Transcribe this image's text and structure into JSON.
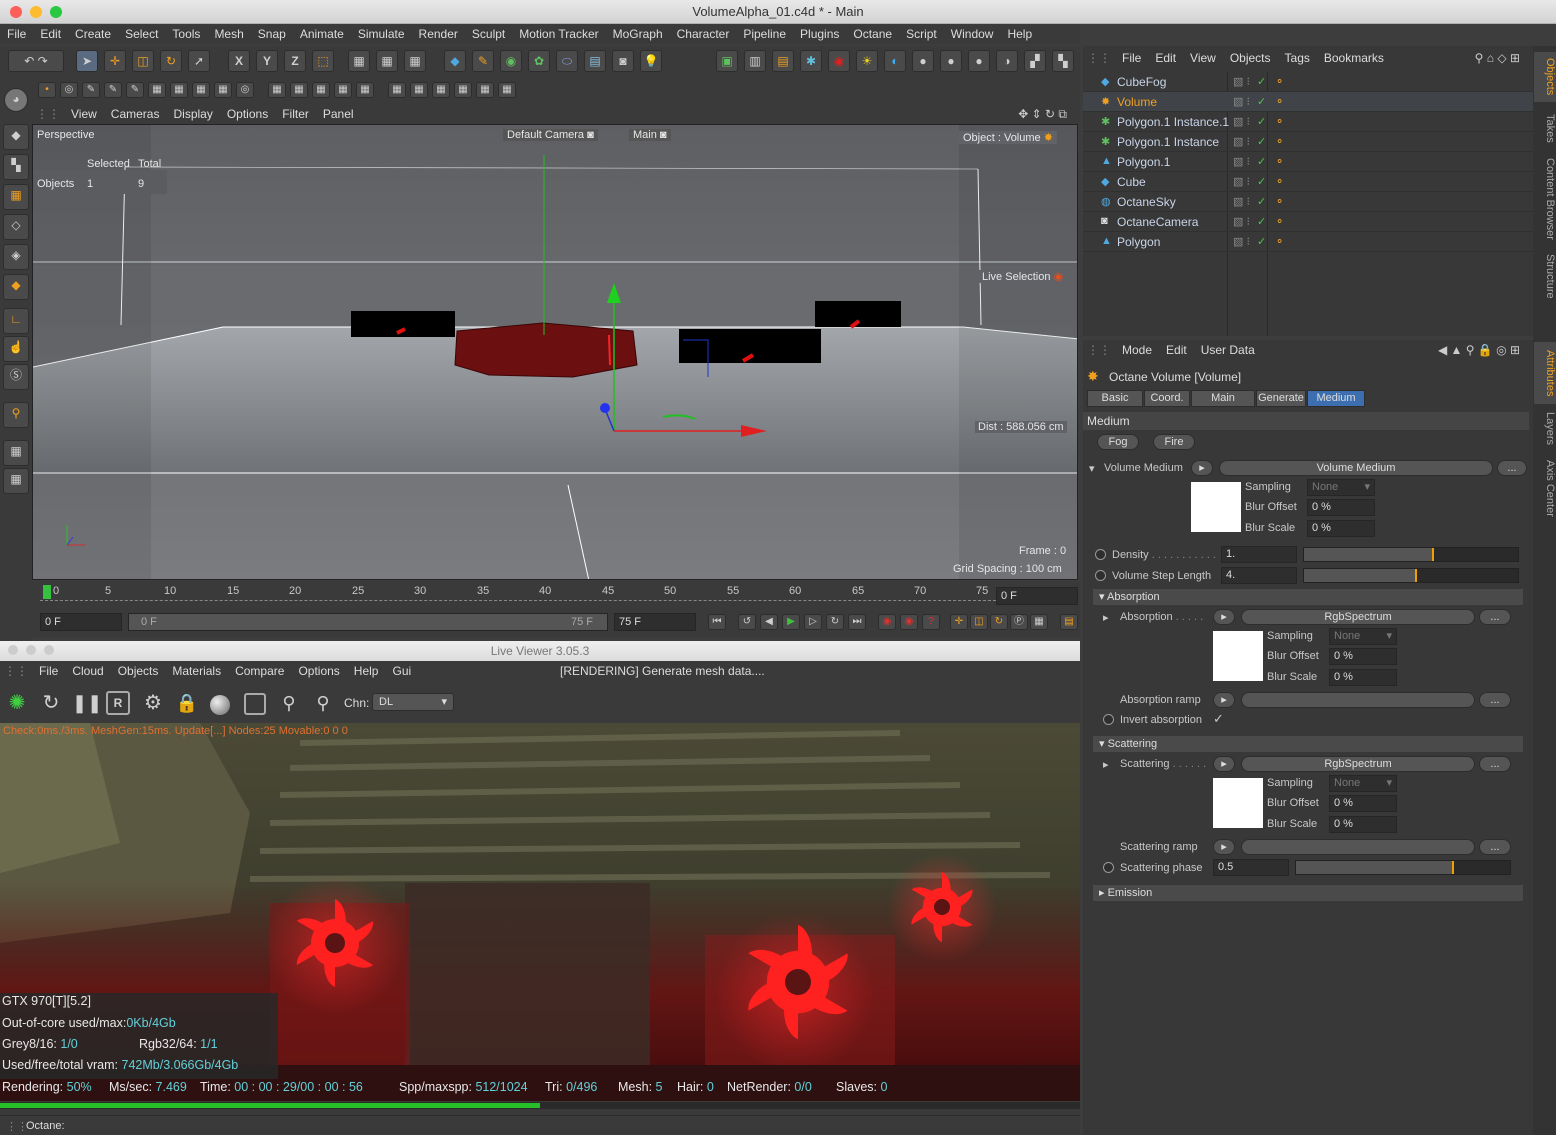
{
  "window": {
    "title": "VolumeAlpha_01.c4d * - Main"
  },
  "menubar": [
    "File",
    "Edit",
    "Create",
    "Select",
    "Tools",
    "Mesh",
    "Snap",
    "Animate",
    "Simulate",
    "Render",
    "Sculpt",
    "Motion Tracker",
    "MoGraph",
    "Character",
    "Pipeline",
    "Plugins",
    "Octane",
    "Script",
    "Window",
    "Help"
  ],
  "toolbar": {
    "axis_x": "X",
    "axis_y": "Y",
    "axis_z": "Z"
  },
  "viewport": {
    "menu": [
      "View",
      "Cameras",
      "Display",
      "Options",
      "Filter",
      "Panel"
    ],
    "name": "Perspective",
    "camera": "Default Camera",
    "main": "Main",
    "object_label": "Object : Volume",
    "stats_header_selected": "Selected",
    "stats_header_total": "Total",
    "stats_row_label": "Objects",
    "stats_selected": "1",
    "stats_total": "9",
    "live_selection": "Live Selection",
    "dist": "Dist : 588.056 cm",
    "frame": "Frame : 0",
    "grid_spacing": "Grid Spacing : 100 cm"
  },
  "timeline": {
    "ticks": [
      "0",
      "5",
      "10",
      "15",
      "20",
      "25",
      "30",
      "35",
      "40",
      "45",
      "50",
      "55",
      "60",
      "65",
      "70",
      "75"
    ],
    "current_frame": "0 F",
    "start_field": "0 F",
    "range_start": "0 F",
    "range_end": "75 F",
    "end_field": "75 F"
  },
  "live_viewer": {
    "title": "Live Viewer 3.05.3",
    "menu": [
      "File",
      "Cloud",
      "Objects",
      "Materials",
      "Compare",
      "Options",
      "Help",
      "Gui"
    ],
    "status": "[RENDERING] Generate mesh data....",
    "channel_label": "Chn:",
    "channel_value": "DL",
    "overlay_text": "Check:0ms./3ms. MeshGen:15ms. Update[...] Nodes:25 Movable:0 0 0",
    "gpu": "GTX 970[T][5.2]",
    "ooc_label": "Out-of-core used/max:",
    "ooc_value": "0Kb/4Gb",
    "grey_label": "Grey8/16:",
    "grey_value": "1/0",
    "rgb_label": "Rgb32/64:",
    "rgb_value": "1/1",
    "vram_label": "Used/free/total vram:",
    "vram_value": "742Mb/3.066Gb/4Gb",
    "rendering_label": "Rendering:",
    "rendering_value": "50%",
    "progress": 0.5,
    "mssec_label": "Ms/sec:",
    "mssec_value": "7.469",
    "time_label": "Time:",
    "time_value": "00 : 00 : 29/00 : 00 : 56",
    "spp_label": "Spp/maxspp:",
    "spp_value": "512/1024",
    "tri_label": "Tri:",
    "tri_value": "0/496",
    "mesh_label": "Mesh:",
    "mesh_value": "5",
    "hair_label": "Hair:",
    "hair_value": "0",
    "netrender_label": "NetRender:",
    "netrender_value": "0/0",
    "slaves_label": "Slaves:",
    "slaves_value": "0",
    "footer": "Octane:"
  },
  "object_manager": {
    "menu": [
      "File",
      "Edit",
      "View",
      "Objects",
      "Tags",
      "Bookmarks"
    ],
    "objects": [
      {
        "name": "CubeFog",
        "icon": "cube-icon",
        "color": "#4fa8e0"
      },
      {
        "name": "Volume",
        "icon": "volume-icon",
        "color": "#f0a020",
        "selected": true
      },
      {
        "name": "Polygon.1 Instance.1",
        "icon": "instance-icon",
        "color": "#60c060"
      },
      {
        "name": "Polygon.1 Instance",
        "icon": "instance-icon",
        "color": "#60c060"
      },
      {
        "name": "Polygon.1",
        "icon": "polygon-icon",
        "color": "#4fa8e0"
      },
      {
        "name": "Cube",
        "icon": "cube-icon",
        "color": "#4fa8e0"
      },
      {
        "name": "OctaneSky",
        "icon": "sky-icon",
        "color": "#4fa8e0"
      },
      {
        "name": "OctaneCamera",
        "icon": "camera-icon",
        "color": "#ddd"
      },
      {
        "name": "Polygon",
        "icon": "polygon-icon",
        "color": "#4fa8e0"
      }
    ]
  },
  "side_tabs_top": [
    "Objects",
    "Takes",
    "Content Browser",
    "Structure"
  ],
  "side_tabs_bottom": [
    "Attributes",
    "Layers",
    "Axis Center"
  ],
  "attributes": {
    "menu": [
      "Mode",
      "Edit",
      "User Data"
    ],
    "object_title": "Octane Volume [Volume]",
    "tabs": [
      "Basic",
      "Coord.",
      "Main",
      "Generate",
      "Medium"
    ],
    "active_tab": "Medium",
    "section": "Medium",
    "sub_tabs": [
      "Fog",
      "Fire"
    ],
    "volume_medium_label": "Volume Medium",
    "volume_medium_value": "Volume Medium",
    "sampling_label": "Sampling",
    "sampling_value": "None",
    "blur_offset_label": "Blur Offset",
    "blur_offset_value": "0 %",
    "blur_scale_label": "Blur Scale",
    "blur_scale_value": "0 %",
    "density_label": "Density",
    "density_value": "1.",
    "density_level": 0.6,
    "step_length_label": "Volume Step Length",
    "step_length_value": "4.",
    "step_length_level": 0.52,
    "absorption_header": "Absorption",
    "absorption_label": "Absorption",
    "absorption_value": "RgbSpectrum",
    "absorption_ramp_label": "Absorption ramp",
    "invert_absorption_label": "Invert absorption",
    "scattering_header": "Scattering",
    "scattering_label": "Scattering",
    "scattering_value": "RgbSpectrum",
    "scattering_ramp_label": "Scattering ramp",
    "scattering_phase_label": "Scattering phase",
    "scattering_phase_value": "0.5",
    "scattering_phase_level": 0.73,
    "emission_header": "Emission",
    "dots": "...",
    "check": "✓"
  }
}
